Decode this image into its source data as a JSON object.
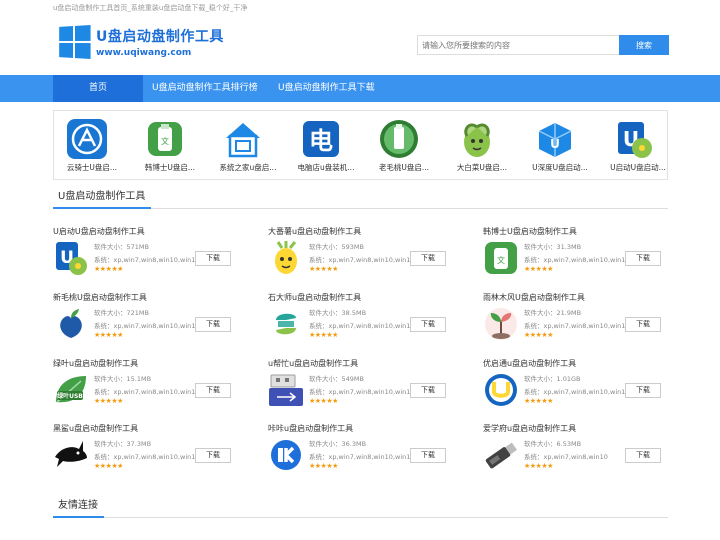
{
  "topbar": {
    "text": "u盘启动盘制作工具首页_系统重装u盘启动盘下载_稳个好_干净"
  },
  "logo": {
    "title": "U盘启动盘制作工具",
    "subtitle": "www.uqiwang.com"
  },
  "search": {
    "placeholder": "请输入您所要搜索的内容",
    "button": "搜索"
  },
  "nav": [
    {
      "label": "首页",
      "active": true
    },
    {
      "label": "U盘启动盘制作工具排行榜",
      "active": false
    },
    {
      "label": "U盘启动盘制作工具下载",
      "active": false
    }
  ],
  "strip": [
    {
      "label": "云骑士U盘启...",
      "icon": "knight-rider-icon",
      "color": "#1976d2"
    },
    {
      "label": "韩博士U盘启...",
      "icon": "usb-drive-icon",
      "color": "#43a047"
    },
    {
      "label": "系统之家u盘启...",
      "icon": "house-icon",
      "color": "#1e88e5"
    },
    {
      "label": "电脑店u盘装机...",
      "icon": "computer-shop-icon",
      "color": "#1565c0"
    },
    {
      "label": "老毛桃U盘启...",
      "icon": "usb-green-icon",
      "color": "#2e7d32"
    },
    {
      "label": "大白菜U盘启...",
      "icon": "cabbage-icon",
      "color": "#8bc34a"
    },
    {
      "label": "U深度U盘启动...",
      "icon": "box-icon",
      "color": "#1e88e5"
    },
    {
      "label": "U启动U盘启动...",
      "icon": "u-disc-icon",
      "color": "#1565c0"
    }
  ],
  "section1": {
    "title": "U盘启动盘制作工具"
  },
  "section2": {
    "title": "友情连接"
  },
  "cards": [
    {
      "name": "U启动U盘启动盘制作工具",
      "size": "软件大小：571MB",
      "sys": "系统：xp,win7,win8,win10,win11",
      "stars": "★★★★★",
      "download": "下载",
      "icon": "u-disc-icon",
      "color": "#1565c0"
    },
    {
      "name": "大番薯u盘启动盘制作工具",
      "size": "软件大小：593MB",
      "sys": "系统：xp,win7,win8,win10,win11",
      "stars": "★★★★★",
      "download": "下载",
      "icon": "sweet-potato-icon",
      "color": "#8bc34a"
    },
    {
      "name": "韩博士U盘启动盘制作工具",
      "size": "软件大小：31.3MB",
      "sys": "系统：xp,win7,win8,win10,win11",
      "stars": "★★★★★",
      "download": "下载",
      "icon": "usb-drive-icon",
      "color": "#43a047"
    },
    {
      "name": "新毛桃U盘启动盘制作工具",
      "size": "软件大小：721MB",
      "sys": "系统：xp,win7,win8,win10,win11",
      "stars": "★★★★★",
      "download": "下载",
      "icon": "peach-icon",
      "color": "#1e5aa8"
    },
    {
      "name": "石大师u盘启动盘制作工具",
      "size": "软件大小：38.5MB",
      "sys": "系统：xp,win7,win8,win10,win11",
      "stars": "★★★★★",
      "download": "下载",
      "icon": "stone-master-icon",
      "color": "#26a69a"
    },
    {
      "name": "雨林木风U盘启动盘制作工具",
      "size": "软件大小：21.9MB",
      "sys": "系统：xp,win7,win8,win10,win11",
      "stars": "★★★★★",
      "download": "下载",
      "icon": "sprout-icon",
      "color": "#e57373"
    },
    {
      "name": "绿叶u盘启动盘制作工具",
      "size": "软件大小：15.1MB",
      "sys": "系统：xp,win7,win8,win10,win11",
      "stars": "★★★★★",
      "download": "下载",
      "icon": "green-leaf-icon",
      "color": "#43a047"
    },
    {
      "name": "u帮忙u盘启动盘制作工具",
      "size": "软件大小：549MB",
      "sys": "系统：xp,win7,win8,win10,win11",
      "stars": "★★★★★",
      "download": "下载",
      "icon": "usb-plug-icon",
      "color": "#3f51b5"
    },
    {
      "name": "优启通u盘启动盘制作工具",
      "size": "软件大小：1.01GB",
      "sys": "系统：xp,win7,win8,win10,win11",
      "stars": "★★★★★",
      "download": "下载",
      "icon": "youqitong-icon",
      "color": "#1565c0"
    },
    {
      "name": "黑鲨u盘启动盘制作工具",
      "size": "软件大小：37.3MB",
      "sys": "系统：xp,win7,win8,win10,win11",
      "stars": "★★★★★",
      "download": "下载",
      "icon": "black-shark-icon",
      "color": "#111111"
    },
    {
      "name": "咔咔u盘启动盘制作工具",
      "size": "软件大小：36.3MB",
      "sys": "系统：xp,win7,win8,win10,win11",
      "stars": "★★★★★",
      "download": "下载",
      "icon": "kaka-icon",
      "color": "#1e6fd9"
    },
    {
      "name": "爱学府u盘启动盘制作工具",
      "size": "软件大小：6.53MB",
      "sys": "系统：xp,win7,win8,win10",
      "stars": "★★★★★",
      "download": "下载",
      "icon": "usb-stick-icon",
      "color": "#555555"
    }
  ]
}
